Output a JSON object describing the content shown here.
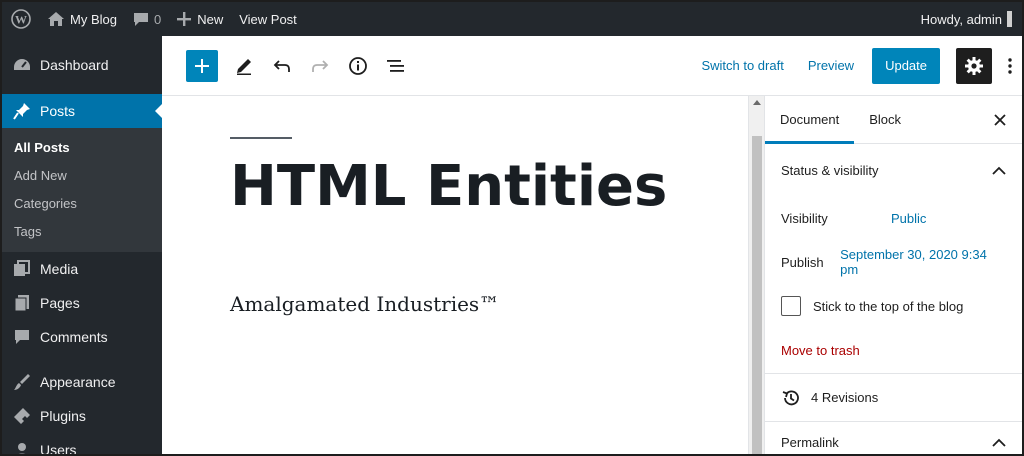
{
  "adminbar": {
    "site_name": "My Blog",
    "comments_count": "0",
    "new_label": "New",
    "view_post_label": "View Post",
    "howdy": "Howdy, admin"
  },
  "sidebar": {
    "items": [
      {
        "label": "Dashboard",
        "icon": "dashboard-icon"
      },
      {
        "label": "Posts",
        "icon": "pin-icon",
        "active": true
      },
      {
        "label": "Media",
        "icon": "media-icon"
      },
      {
        "label": "Pages",
        "icon": "pages-icon"
      },
      {
        "label": "Comments",
        "icon": "comment-icon"
      },
      {
        "label": "Appearance",
        "icon": "brush-icon"
      },
      {
        "label": "Plugins",
        "icon": "plugin-icon"
      },
      {
        "label": "Users",
        "icon": "user-icon"
      }
    ],
    "submenu": [
      "All Posts",
      "Add New",
      "Categories",
      "Tags"
    ]
  },
  "toolbar": {
    "switch_to_draft": "Switch to draft",
    "preview": "Preview",
    "update": "Update"
  },
  "editor": {
    "title": "HTML Entities",
    "paragraph": "Amalgamated Industries™"
  },
  "settings": {
    "tabs": [
      "Document",
      "Block"
    ],
    "status_heading": "Status & visibility",
    "visibility_label": "Visibility",
    "visibility_value": "Public",
    "publish_label": "Publish",
    "publish_value": "September 30, 2020 9:34 pm",
    "sticky_label": "Stick to the top of the blog",
    "trash_label": "Move to trash",
    "revisions_label": "4 Revisions",
    "permalink_label": "Permalink"
  },
  "colors": {
    "admin_dark": "#23282d",
    "accent": "#0073aa",
    "button_blue": "#0085ba",
    "trash_red": "#a00"
  }
}
